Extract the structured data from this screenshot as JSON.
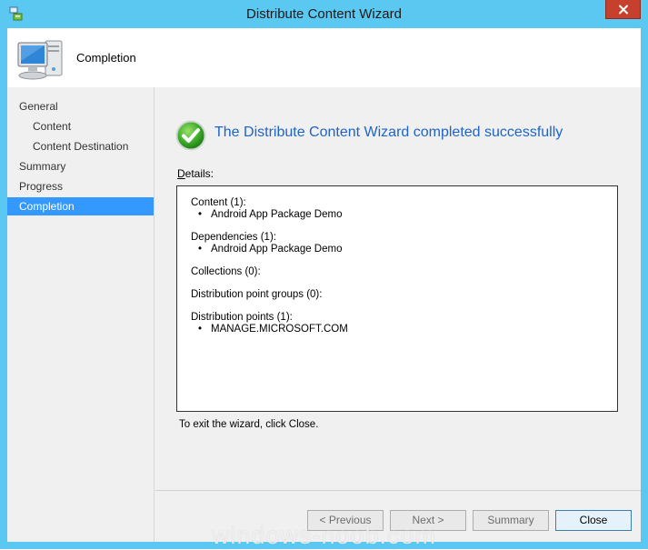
{
  "window": {
    "title": "Distribute Content Wizard",
    "accent_color": "#5ac8f0",
    "close_icon": "close-icon"
  },
  "header": {
    "title": "Completion",
    "icon": "computer-icon"
  },
  "nav": {
    "items": [
      {
        "label": "General",
        "level": 1,
        "active": false
      },
      {
        "label": "Content",
        "level": 2,
        "active": false
      },
      {
        "label": "Content Destination",
        "level": 2,
        "active": false
      },
      {
        "label": "Summary",
        "level": 1,
        "active": false
      },
      {
        "label": "Progress",
        "level": 1,
        "active": false
      },
      {
        "label": "Completion",
        "level": 1,
        "active": true
      }
    ],
    "active_color": "#3399ff"
  },
  "main": {
    "status_icon": "checkmark-icon",
    "status_text": "The Distribute Content Wizard completed successfully",
    "status_color": "#1e64c8",
    "details_label_underlined": "D",
    "details_label_rest": "etails:",
    "details": [
      {
        "title": "Content (1):",
        "items": [
          "Android App Package Demo"
        ]
      },
      {
        "title": "Dependencies (1):",
        "items": [
          "Android App Package Demo"
        ]
      },
      {
        "title": "Collections (0):",
        "items": []
      },
      {
        "title": "Distribution point groups (0):",
        "items": []
      },
      {
        "title": "Distribution points (1):",
        "items": [
          "MANAGE.MICROSOFT.COM"
        ]
      }
    ],
    "exit_text": "To exit the wizard, click Close."
  },
  "buttons": {
    "previous": "< Previous",
    "next": "Next >",
    "summary": "Summary",
    "close": "Close"
  },
  "watermark": "windows-noob.com"
}
